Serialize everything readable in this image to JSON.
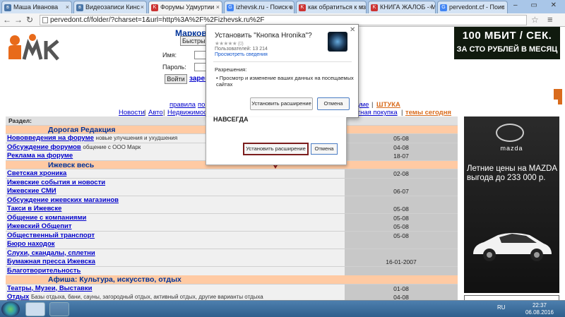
{
  "tabs": [
    {
      "label": "Маша Иванова",
      "icon": "VK",
      "color": "#4a76a8"
    },
    {
      "label": "Видеозаписи Кинс",
      "icon": "VK",
      "color": "#4a76a8"
    },
    {
      "label": "Форумы Удмуртии",
      "icon": "K",
      "color": "#c33"
    },
    {
      "label": "izhevsk.ru - Поиск в",
      "icon": "G",
      "color": "#4285f4"
    },
    {
      "label": "как обратиться к мз",
      "icon": "K",
      "color": "#c33"
    },
    {
      "label": "КНИГА ЖАЛОБ - М",
      "icon": "K",
      "color": "#c33"
    },
    {
      "label": "pervedont.cf - Поис",
      "icon": "G",
      "color": "#4285f4"
    }
  ],
  "url": "pervedont.cf/folder/?charset=1&url=http%3A%2F%2Fizhevsk.ru%2F",
  "site": {
    "title": "Марков",
    "select_value": "Быстрый",
    "login_label": "Имя:",
    "password_label": "Пароль:",
    "enter_button": "Войти",
    "register_link": "зарег"
  },
  "ad_top": {
    "line1": "100 МБИТ / СЕК.",
    "line2": "ЗА СТО РУБЛЕЙ В МЕСЯЦ"
  },
  "nav": {
    "row1": [
      "правила",
      "по",
      "уме",
      "ШТУКА"
    ],
    "row2": [
      "Новости",
      "Авто",
      "Недвижимост",
      "стная покупка",
      "темы сегодня"
    ]
  },
  "forum": {
    "section_header": "Раздел:",
    "rows": [
      {
        "type": "cat",
        "title": "Дорогая Редакция"
      },
      {
        "type": "row",
        "title": "Нововведения на форуме",
        "desc": "новые улучшения и ухудшения",
        "date": "05-08"
      },
      {
        "type": "row",
        "title": "Обсуждение форумов",
        "desc": "общение с ООО Марк",
        "date": "04-08"
      },
      {
        "type": "row",
        "title": "Реклама на форуме",
        "desc": "",
        "date": "18-07"
      },
      {
        "type": "cat",
        "title": "Ижевск весь"
      },
      {
        "type": "row",
        "title": "Светская хроника",
        "desc": "",
        "date": "02-08"
      },
      {
        "type": "row",
        "title": "Ижевские события и новости",
        "desc": "",
        "date": ""
      },
      {
        "type": "row",
        "title": "Ижевские СМИ",
        "desc": "",
        "date": "06-07"
      },
      {
        "type": "row",
        "title": "Обсуждение ижевских магазинов",
        "desc": "",
        "date": ""
      },
      {
        "type": "row",
        "title": "Такси в Ижевске",
        "desc": "",
        "date": "05-08"
      },
      {
        "type": "row",
        "title": "Общение с компаниями",
        "desc": "",
        "date": "05-08"
      },
      {
        "type": "row",
        "title": "Ижевский Общепит",
        "desc": "",
        "date": "05-08"
      },
      {
        "type": "row",
        "title": "Общественный транспорт",
        "desc": "",
        "date": "05-08"
      },
      {
        "type": "row",
        "title": "Бюро находок",
        "desc": "",
        "date": ""
      },
      {
        "type": "row",
        "title": "Слухи, скандалы, сплетни",
        "desc": "",
        "date": ""
      },
      {
        "type": "row",
        "title": "Бумажная пресса Ижевска",
        "desc": "",
        "date": "16-01-2007"
      },
      {
        "type": "row",
        "title": "Благотворительность",
        "desc": "",
        "date": ""
      },
      {
        "type": "cat",
        "title": "Афиша: Культура, искусство, отдых"
      },
      {
        "type": "row",
        "title": "Театры, Музеи, Выставки",
        "desc": "",
        "date": "01-08"
      },
      {
        "type": "row",
        "title": "Отдых",
        "desc": "Базы отдыха, бани, сауны, загородный отдых, активный отдых, другие варианты отдыха",
        "date": "04-08"
      },
      {
        "type": "row",
        "title": "",
        "desc": "",
        "date": "05-08"
      }
    ]
  },
  "ad_right": {
    "brand": "mazda",
    "text": "Летние цены на MAZDA выгода до 233 000 р."
  },
  "dialog": {
    "title": "Установить \"Кнопка Hronika\"?",
    "stars": "★★★★★ (0)",
    "users": "Пользователей: 13 214",
    "details_link": "Просмотреть сведения",
    "permissions_heading": "Разрешения:",
    "permission_item": "Просмотр и изменение ваших данных на посещаемых сайтах",
    "install_button": "Установить расширение",
    "cancel_button": "Отмена"
  },
  "dialog2": {
    "fragment": "НАВСЕГДА",
    "install_button": "Установить расширение",
    "cancel_button": "Отмена"
  },
  "taskbar": {
    "lang": "RU",
    "time": "22:37",
    "date": "06.08.2016"
  }
}
